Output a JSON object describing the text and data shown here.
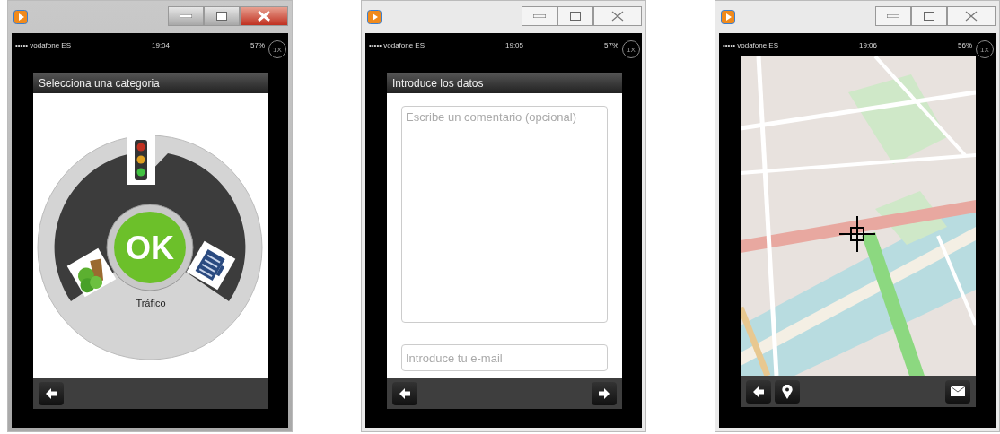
{
  "windows": [
    {
      "active": true,
      "status_bar": {
        "carrier": "••••• vodafone ES",
        "time": "19:04",
        "battery": "57%"
      },
      "zoom_badge": "1X",
      "screen": {
        "kind": "category",
        "title": "Selecciona una categoria",
        "center_button": "OK",
        "category_label": "Tráfico"
      },
      "toolbar": {
        "left_buttons": [
          {
            "kind": "back"
          }
        ]
      }
    },
    {
      "active": false,
      "status_bar": {
        "carrier": "••••• vodafone ES",
        "time": "19:05",
        "battery": "57%"
      },
      "zoom_badge": "1X",
      "screen": {
        "kind": "form",
        "title": "Introduce los datos",
        "comment_placeholder": "Escribe un comentario (opcional)",
        "email_placeholder": "Introduce tu e-mail"
      },
      "toolbar": {
        "left_buttons": [
          {
            "kind": "back"
          }
        ],
        "right_buttons": [
          {
            "kind": "forward"
          }
        ]
      }
    },
    {
      "active": false,
      "status_bar": {
        "carrier": "••••• vodafone ES",
        "time": "19:06",
        "battery": "56%"
      },
      "zoom_badge": "1X",
      "screen": {
        "kind": "map"
      },
      "toolbar": {
        "left_buttons": [
          {
            "kind": "back"
          },
          {
            "kind": "location"
          }
        ],
        "right_buttons": [
          {
            "kind": "mail"
          }
        ]
      }
    }
  ]
}
